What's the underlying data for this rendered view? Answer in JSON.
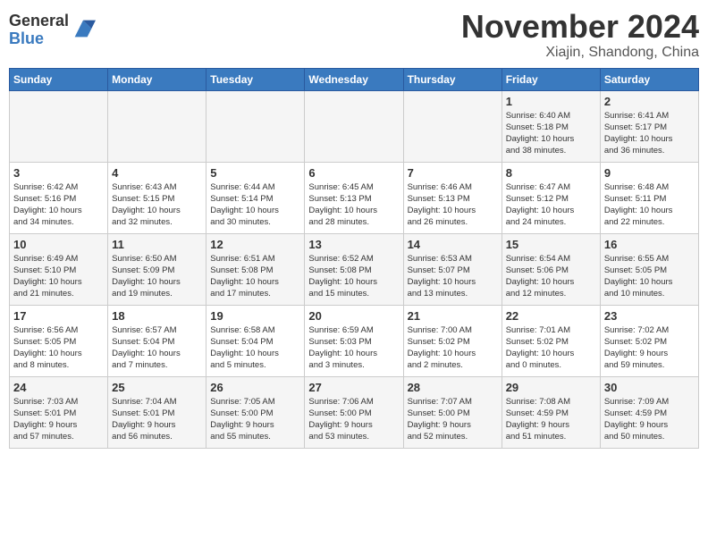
{
  "header": {
    "logo_general": "General",
    "logo_blue": "Blue",
    "month_title": "November 2024",
    "location": "Xiajin, Shandong, China"
  },
  "weekdays": [
    "Sunday",
    "Monday",
    "Tuesday",
    "Wednesday",
    "Thursday",
    "Friday",
    "Saturday"
  ],
  "weeks": [
    [
      {
        "day": "",
        "info": ""
      },
      {
        "day": "",
        "info": ""
      },
      {
        "day": "",
        "info": ""
      },
      {
        "day": "",
        "info": ""
      },
      {
        "day": "",
        "info": ""
      },
      {
        "day": "1",
        "info": "Sunrise: 6:40 AM\nSunset: 5:18 PM\nDaylight: 10 hours\nand 38 minutes."
      },
      {
        "day": "2",
        "info": "Sunrise: 6:41 AM\nSunset: 5:17 PM\nDaylight: 10 hours\nand 36 minutes."
      }
    ],
    [
      {
        "day": "3",
        "info": "Sunrise: 6:42 AM\nSunset: 5:16 PM\nDaylight: 10 hours\nand 34 minutes."
      },
      {
        "day": "4",
        "info": "Sunrise: 6:43 AM\nSunset: 5:15 PM\nDaylight: 10 hours\nand 32 minutes."
      },
      {
        "day": "5",
        "info": "Sunrise: 6:44 AM\nSunset: 5:14 PM\nDaylight: 10 hours\nand 30 minutes."
      },
      {
        "day": "6",
        "info": "Sunrise: 6:45 AM\nSunset: 5:13 PM\nDaylight: 10 hours\nand 28 minutes."
      },
      {
        "day": "7",
        "info": "Sunrise: 6:46 AM\nSunset: 5:13 PM\nDaylight: 10 hours\nand 26 minutes."
      },
      {
        "day": "8",
        "info": "Sunrise: 6:47 AM\nSunset: 5:12 PM\nDaylight: 10 hours\nand 24 minutes."
      },
      {
        "day": "9",
        "info": "Sunrise: 6:48 AM\nSunset: 5:11 PM\nDaylight: 10 hours\nand 22 minutes."
      }
    ],
    [
      {
        "day": "10",
        "info": "Sunrise: 6:49 AM\nSunset: 5:10 PM\nDaylight: 10 hours\nand 21 minutes."
      },
      {
        "day": "11",
        "info": "Sunrise: 6:50 AM\nSunset: 5:09 PM\nDaylight: 10 hours\nand 19 minutes."
      },
      {
        "day": "12",
        "info": "Sunrise: 6:51 AM\nSunset: 5:08 PM\nDaylight: 10 hours\nand 17 minutes."
      },
      {
        "day": "13",
        "info": "Sunrise: 6:52 AM\nSunset: 5:08 PM\nDaylight: 10 hours\nand 15 minutes."
      },
      {
        "day": "14",
        "info": "Sunrise: 6:53 AM\nSunset: 5:07 PM\nDaylight: 10 hours\nand 13 minutes."
      },
      {
        "day": "15",
        "info": "Sunrise: 6:54 AM\nSunset: 5:06 PM\nDaylight: 10 hours\nand 12 minutes."
      },
      {
        "day": "16",
        "info": "Sunrise: 6:55 AM\nSunset: 5:05 PM\nDaylight: 10 hours\nand 10 minutes."
      }
    ],
    [
      {
        "day": "17",
        "info": "Sunrise: 6:56 AM\nSunset: 5:05 PM\nDaylight: 10 hours\nand 8 minutes."
      },
      {
        "day": "18",
        "info": "Sunrise: 6:57 AM\nSunset: 5:04 PM\nDaylight: 10 hours\nand 7 minutes."
      },
      {
        "day": "19",
        "info": "Sunrise: 6:58 AM\nSunset: 5:04 PM\nDaylight: 10 hours\nand 5 minutes."
      },
      {
        "day": "20",
        "info": "Sunrise: 6:59 AM\nSunset: 5:03 PM\nDaylight: 10 hours\nand 3 minutes."
      },
      {
        "day": "21",
        "info": "Sunrise: 7:00 AM\nSunset: 5:02 PM\nDaylight: 10 hours\nand 2 minutes."
      },
      {
        "day": "22",
        "info": "Sunrise: 7:01 AM\nSunset: 5:02 PM\nDaylight: 10 hours\nand 0 minutes."
      },
      {
        "day": "23",
        "info": "Sunrise: 7:02 AM\nSunset: 5:02 PM\nDaylight: 9 hours\nand 59 minutes."
      }
    ],
    [
      {
        "day": "24",
        "info": "Sunrise: 7:03 AM\nSunset: 5:01 PM\nDaylight: 9 hours\nand 57 minutes."
      },
      {
        "day": "25",
        "info": "Sunrise: 7:04 AM\nSunset: 5:01 PM\nDaylight: 9 hours\nand 56 minutes."
      },
      {
        "day": "26",
        "info": "Sunrise: 7:05 AM\nSunset: 5:00 PM\nDaylight: 9 hours\nand 55 minutes."
      },
      {
        "day": "27",
        "info": "Sunrise: 7:06 AM\nSunset: 5:00 PM\nDaylight: 9 hours\nand 53 minutes."
      },
      {
        "day": "28",
        "info": "Sunrise: 7:07 AM\nSunset: 5:00 PM\nDaylight: 9 hours\nand 52 minutes."
      },
      {
        "day": "29",
        "info": "Sunrise: 7:08 AM\nSunset: 4:59 PM\nDaylight: 9 hours\nand 51 minutes."
      },
      {
        "day": "30",
        "info": "Sunrise: 7:09 AM\nSunset: 4:59 PM\nDaylight: 9 hours\nand 50 minutes."
      }
    ]
  ]
}
